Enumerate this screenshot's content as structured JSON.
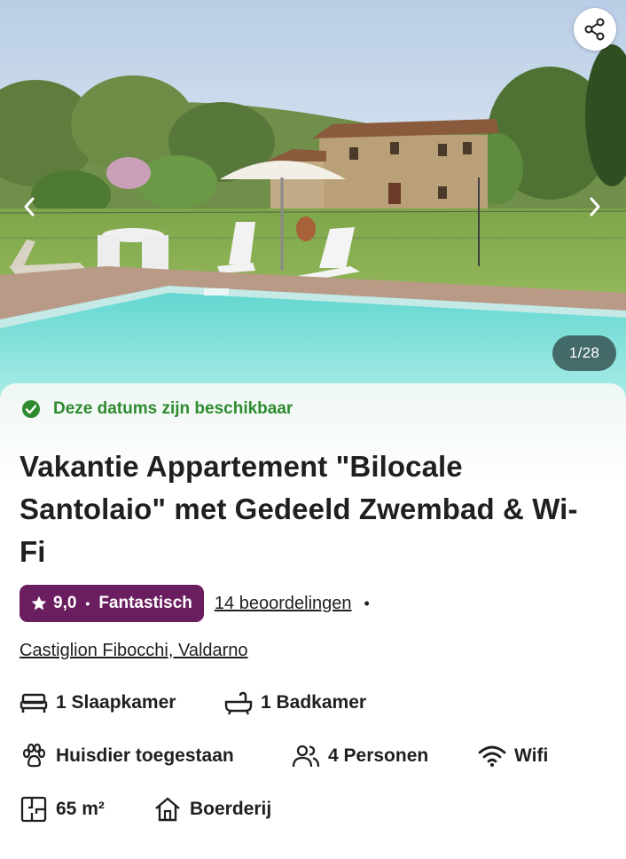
{
  "gallery": {
    "counter": "1/28",
    "icons": {
      "share": "share-icon",
      "prev": "chevron-left-icon",
      "next": "chevron-right-icon"
    }
  },
  "availability": {
    "text": "Deze datums zijn beschikbaar",
    "icon": "check-circle-icon",
    "color": "#2e8b2e"
  },
  "listing": {
    "title": "Vakantie Appartement \"Bilocale Santolaio\" met Gedeeld Zwembad & Wi-Fi",
    "rating": {
      "score": "9,0",
      "separator": "•",
      "label": "Fantastisch",
      "badge_color": "#6a1d5f",
      "reviews": "14 beoordelingen",
      "trailing_bullet": "•"
    },
    "location": "Castiglion Fibocchi, Valdarno"
  },
  "features": {
    "bedrooms": {
      "label": "1 Slaapkamer",
      "icon": "bed-icon"
    },
    "bathrooms": {
      "label": "1 Badkamer",
      "icon": "bathtub-icon"
    },
    "pets": {
      "label": "Huisdier toegestaan",
      "icon": "paw-icon"
    },
    "persons": {
      "label": "4 Personen",
      "icon": "people-icon"
    },
    "wifi": {
      "label": "Wifi",
      "icon": "wifi-icon"
    },
    "area": {
      "label": "65 m²",
      "icon": "floor-plan-icon"
    },
    "type": {
      "label": "Boerderij",
      "icon": "house-icon"
    }
  }
}
